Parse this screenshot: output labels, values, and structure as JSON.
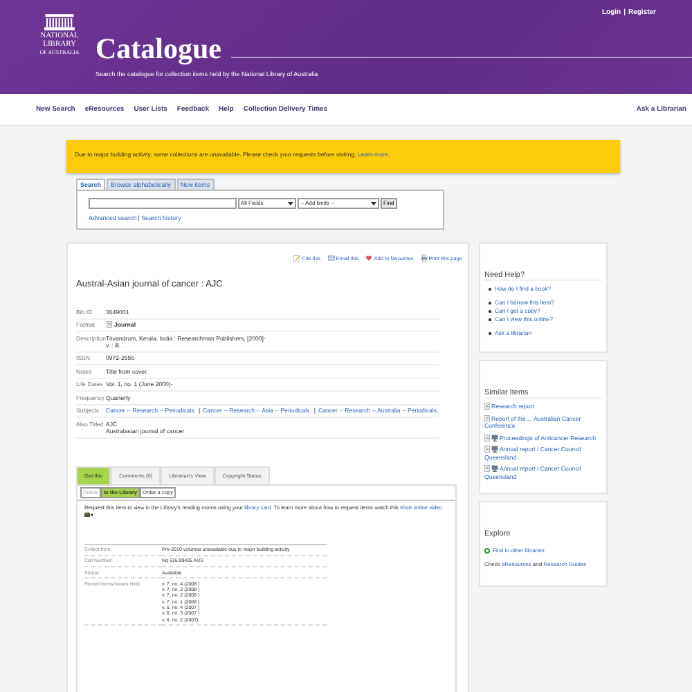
{
  "header": {
    "logo_lines": [
      "NATIONAL",
      "LIBRARY",
      "OF AUSTRALIA"
    ],
    "title": "Catalogue",
    "subtitle": "Search the catalogue for collection items held by the National Library of Australia",
    "user_links": [
      "Login",
      "Register"
    ],
    "user_separator": "|"
  },
  "nav": {
    "items": [
      "New Search",
      "eResources",
      "User Lists",
      "Feedback",
      "Help",
      "Collection Delivery Times"
    ],
    "aside": "Ask a Librarian"
  },
  "notice": {
    "text": "Due to major building activity, some collections are unavailable. Please check your requests before visiting.",
    "link": "Learn more."
  },
  "search": {
    "tabs": [
      {
        "label": "Search",
        "selected": true
      },
      {
        "label": "Browse alphabetically",
        "selected": false
      },
      {
        "label": "New items",
        "selected": false
      }
    ],
    "field_select": "All Fields",
    "limits_select": "-- Add limits --",
    "button": "Find",
    "links": [
      "Advanced search",
      "Search history"
    ],
    "separator": "|"
  },
  "record": {
    "actions": [
      {
        "kind": "cite",
        "label": "Cite this"
      },
      {
        "kind": "email",
        "label": "Email this"
      },
      {
        "kind": "favourite",
        "label": "Add to favourites"
      },
      {
        "kind": "print",
        "label": "Print this page"
      }
    ],
    "title": "Austral-Asian journal of cancer : AJC",
    "fields": [
      {
        "label": "Bib ID",
        "kind": "text",
        "values": [
          "3649001"
        ]
      },
      {
        "label": "Format",
        "kind": "format",
        "values": [
          "Journal"
        ]
      },
      {
        "label": "Description",
        "kind": "text",
        "values": [
          "Trivandrum, Kerala, India : Researchman Publishers, [2000]-",
          "v. : ill."
        ]
      },
      {
        "label": "ISSN",
        "kind": "text",
        "values": [
          "0972-2556"
        ]
      },
      {
        "label": "Notes",
        "kind": "text",
        "values": [
          "Title from cover."
        ]
      },
      {
        "label": "Life Dates",
        "kind": "text",
        "values": [
          "Vol. 1, no. 1 (June 2000)-"
        ]
      },
      {
        "label": "Frequency",
        "kind": "text",
        "values": [
          "Quarterly"
        ]
      },
      {
        "label": "Subjects",
        "kind": "links",
        "separator": "|",
        "values": [
          "Cancer -- Research -- Periodicals.",
          "Cancer -- Research -- Asia -- Periodicals.",
          "Cancer -- Research -- Australia -- Periodicals."
        ]
      },
      {
        "label": "Also Titled",
        "kind": "text",
        "values": [
          "AJC",
          "Australasian journal of cancer"
        ]
      }
    ],
    "tabs": [
      {
        "label": "Get this",
        "selected": true
      },
      {
        "label": "Comments (0)",
        "selected": false
      },
      {
        "label": "Librarian's View",
        "selected": false
      },
      {
        "label": "Copyright Status",
        "selected": false
      }
    ],
    "subtabs": [
      {
        "label": "Online",
        "selected": false,
        "disabled": true
      },
      {
        "label": "In the Library",
        "selected": true,
        "disabled": false
      },
      {
        "label": "Order a copy",
        "selected": false,
        "disabled": false
      }
    ],
    "request": [
      {
        "text": "Request this item to view in the Library's reading rooms using your ",
        "link": false
      },
      {
        "text": "library card",
        "link": true
      },
      {
        "text": ". To learn more about how to request items watch this ",
        "link": false
      },
      {
        "text": "short online video",
        "link": true
      }
    ],
    "holdings": [
      {
        "label": "Collect from:",
        "values": [
          "Pre-2010 volumes unavailable due to major building activity"
        ]
      },
      {
        "label": "Call Number:",
        "values": [
          "Nq 616.99405 AUS"
        ]
      },
      {
        "label": "Status:",
        "values": [
          "Available"
        ]
      },
      {
        "label": "Recent Items/Issues Held:",
        "values": [
          "v. 7, no. 4 (2008 )",
          "v. 7, no. 3 (2008 )",
          "v. 7, no. 2 (2008 )",
          "v. 7, no. 1 (2008 )",
          "v. 6, no. 4 (2007 )",
          "v. 6, no. 3 (2007 )",
          "v. 6, no. 2 (2007)"
        ]
      }
    ]
  },
  "sidebar": {
    "help": {
      "title": "Need Help?",
      "groups": [
        [
          "How do I find a book?"
        ],
        [
          "Can I borrow this item?",
          "Can I get a copy?",
          "Can I view this online?"
        ],
        [
          "Ask a librarian"
        ]
      ]
    },
    "similar": {
      "title": "Similar Items",
      "items": [
        {
          "title": "Research report",
          "online": false
        },
        {
          "title": "Report of the ... Australian Cancer Conference",
          "online": false
        },
        {
          "title": "Proceedings of Anticancer Research",
          "online": true
        },
        {
          "title": "Annual report / Cancer Council Queensland",
          "online": true
        },
        {
          "title": "Annual report / Cancer Council Queensland",
          "online": true
        }
      ]
    },
    "explore": {
      "title": "Explore",
      "find_link": "Find in other libraries",
      "check": [
        {
          "text": "Check ",
          "link": false
        },
        {
          "text": "eResources",
          "link": true
        },
        {
          "text": " and ",
          "link": false
        },
        {
          "text": "Research Guides",
          "link": true
        }
      ]
    }
  }
}
